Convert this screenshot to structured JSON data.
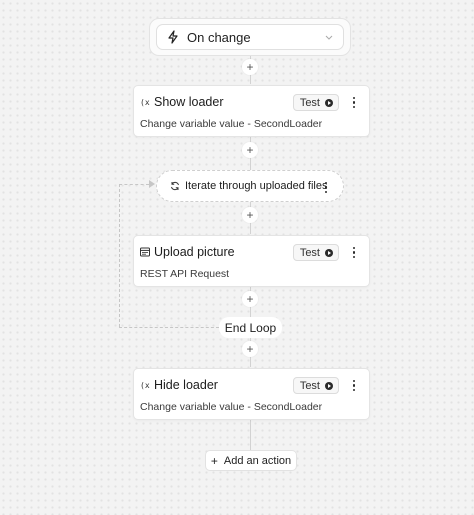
{
  "trigger": {
    "label": "On change",
    "icon": "bolt-icon"
  },
  "steps": [
    {
      "title": "Show loader",
      "subtitle": "Change variable value - SecondLoader",
      "test_label": "Test",
      "icon": "variable-icon"
    },
    {
      "title": "Upload picture",
      "subtitle": "REST API Request",
      "test_label": "Test",
      "icon": "api-window-icon"
    },
    {
      "title": "Hide loader",
      "subtitle": "Change variable value - SecondLoader",
      "test_label": "Test",
      "icon": "variable-icon"
    }
  ],
  "loop": {
    "label": "Iterate through uploaded files",
    "end_label": "End Loop",
    "icon": "loop-icon"
  },
  "add_action": {
    "label": "Add an action"
  },
  "plus_symbol": "+",
  "colors": {
    "background": "#f3f3f3",
    "card": "#ffffff",
    "border": "#e4e4e4",
    "connector": "#d2d2d2"
  }
}
